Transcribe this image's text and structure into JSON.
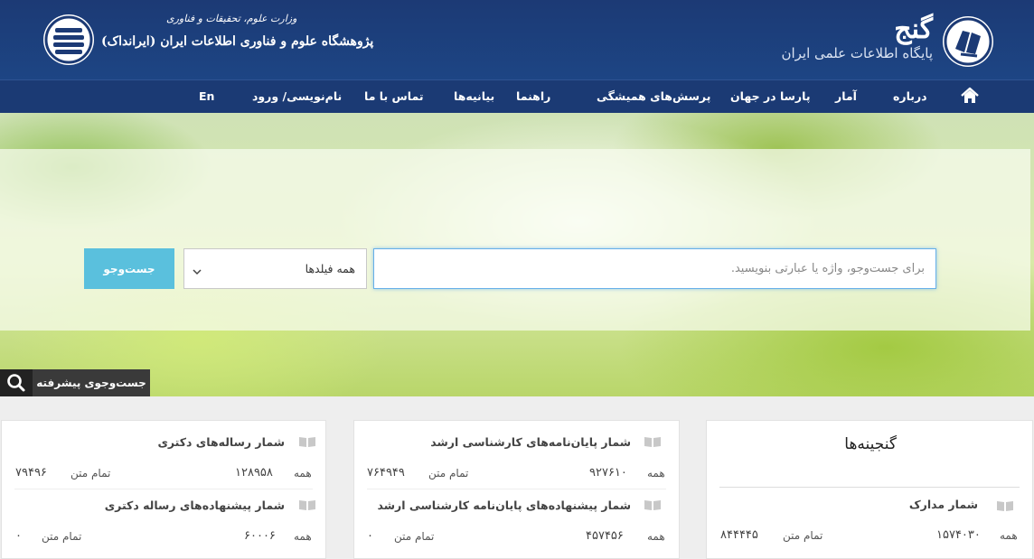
{
  "header": {
    "ganj_title": "گنج",
    "ganj_subtitle": "پایگاه اطلاعات علمی ایران",
    "ministry_text": "وزارت علوم، تحقیقات و فناوری",
    "institute_name": "پژوهشگاه علوم و فناوری اطلاعات ایران (ایرانداک)"
  },
  "nav": {
    "home_icon": "home-icon",
    "items": [
      "درباره",
      "آمار",
      "پارسا در جهان",
      "پرسش‌های همیشگی",
      "راهنما",
      "بیانیه‌ها",
      "تماس با ما",
      "نام‌نویسی/ ورود",
      "En"
    ]
  },
  "search": {
    "placeholder": "برای جست‌وجو، واژه یا عبارتی بنویسید.",
    "field_selected": "همه فیلدها",
    "button_label": "جست‌وجو",
    "advanced_label": "جست‌وجوی پیشرفته"
  },
  "stats": {
    "treasures": {
      "title": "گنجینه‌ها",
      "docs_title": "شمار مدارک",
      "all_label": "همه",
      "all_value": "۱۵۷۴۰۳۰",
      "fulltext_label": "تمام متن",
      "fulltext_value": "۸۴۴۴۴۵"
    },
    "masters": {
      "theses_title": "شمار پایان‌نامه‌های کارشناسی ارشد",
      "theses_all_label": "همه",
      "theses_all_value": "۹۲۷۶۱۰",
      "theses_fulltext_label": "تمام متن",
      "theses_fulltext_value": "۷۶۴۹۴۹",
      "proposals_title": "شمار پیشنهاده‌های پایان‌نامه کارشناسی ارشد",
      "proposals_all_label": "همه",
      "proposals_all_value": "۴۵۷۴۵۶",
      "proposals_fulltext_label": "تمام متن",
      "proposals_fulltext_value": "۰"
    },
    "phd": {
      "theses_title": "شمار رساله‌های دکتری",
      "theses_all_label": "همه",
      "theses_all_value": "۱۲۸۹۵۸",
      "theses_fulltext_label": "تمام متن",
      "theses_fulltext_value": "۷۹۴۹۶",
      "proposals_title": "شمار پیشنهاده‌های رساله دکتری",
      "proposals_all_label": "همه",
      "proposals_all_value": "۶۰۰۰۶",
      "proposals_fulltext_label": "تمام متن",
      "proposals_fulltext_value": "۰"
    }
  },
  "colors": {
    "header_bg": "#1c3a75",
    "nav_bg": "#1b3a74",
    "search_button": "#5ac0dd",
    "advanced_search_bg": "#3a3a3a"
  }
}
